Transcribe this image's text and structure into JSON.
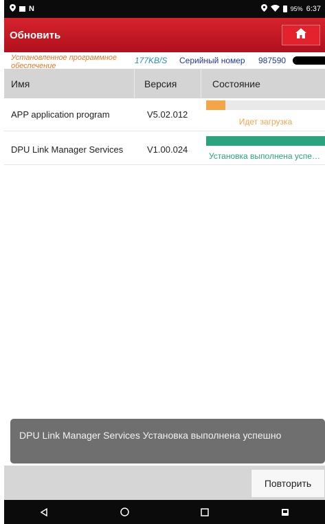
{
  "status_bar": {
    "battery": "95%",
    "time": "6:37"
  },
  "header": {
    "title": "Обновить",
    "home_icon": "home-icon"
  },
  "info": {
    "installed_label": "Установленное программное обеспечение",
    "speed": "177KB/S",
    "serial_label": "Серийный номер",
    "serial_number": "987590"
  },
  "table": {
    "columns": [
      "Имя",
      "Версия",
      "Состояние"
    ],
    "rows": [
      {
        "name": "APP application program",
        "version": "V5.02.012",
        "progress": 0.16,
        "progress_color": "#f3a54a",
        "state": "Идет загрузка",
        "state_color": "#f3a54a"
      },
      {
        "name": "DPU Link Manager Services",
        "version": "V1.00.024",
        "progress": 1.0,
        "progress_color": "#2aa37e",
        "state": "Установка выполнена успешно",
        "state_color": "#2aa37e"
      }
    ]
  },
  "toast": {
    "message": "DPU Link Manager Services Установка выполнена успешно"
  },
  "actions": {
    "retry_label": "Повторить"
  },
  "nav": {
    "icons": [
      "back-icon",
      "home-circle-icon",
      "recents-icon",
      "screenshot-icon"
    ]
  },
  "colors": {
    "brand_red": "#c8182a",
    "pending": "#f3a54a",
    "done": "#2aa37e"
  }
}
